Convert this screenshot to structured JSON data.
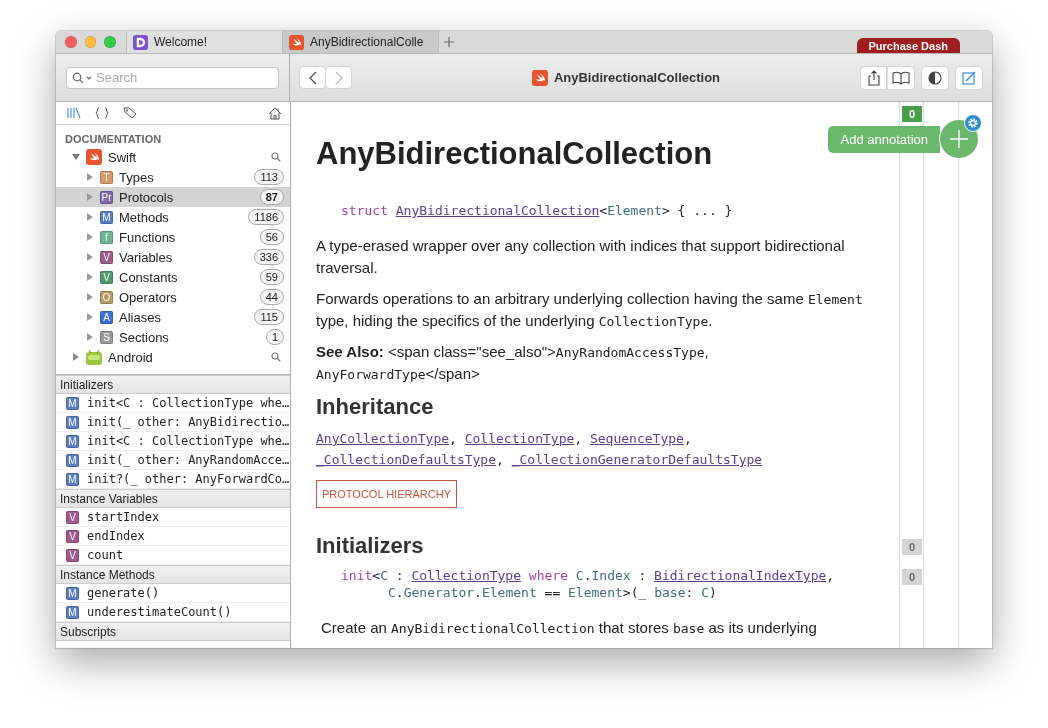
{
  "tabs": [
    {
      "title": "Welcome!",
      "selected": false
    },
    {
      "title": "AnyBidirectionalColle",
      "selected": true
    }
  ],
  "purchase_badge": "Purchase Dash",
  "search": {
    "placeholder": "Search"
  },
  "toolbar": {
    "title": "AnyBidirectionalCollection"
  },
  "tree": {
    "heading": "DOCUMENTATION",
    "items": [
      {
        "label": "Swift",
        "expanded": true,
        "selected": false,
        "children": [
          {
            "badge": "T",
            "color": "#d99a6c",
            "label": "Types",
            "count": "113",
            "selected": false
          },
          {
            "badge": "Pr",
            "color": "#8069a8",
            "label": "Protocols",
            "count": "87",
            "selected": true
          },
          {
            "badge": "M",
            "color": "#5a7fc4",
            "label": "Methods",
            "count": "1186",
            "selected": false
          },
          {
            "badge": "f",
            "color": "#6db592",
            "label": "Functions",
            "count": "56",
            "selected": false
          },
          {
            "badge": "V",
            "color": "#a05a8c",
            "label": "Variables",
            "count": "336",
            "selected": false
          },
          {
            "badge": "V",
            "color": "#4f9a6e",
            "label": "Constants",
            "count": "59",
            "selected": false
          },
          {
            "badge": "O",
            "color": "#b89a64",
            "label": "Operators",
            "count": "44",
            "selected": false
          },
          {
            "badge": "A",
            "color": "#3f6fd1",
            "label": "Aliases",
            "count": "115",
            "selected": false
          },
          {
            "badge": "S",
            "color": "#9a9a9a",
            "label": "Sections",
            "count": "1",
            "selected": false
          }
        ]
      },
      {
        "label": "Android",
        "expanded": false,
        "selected": false
      }
    ]
  },
  "index": [
    {
      "title": "Initializers",
      "items": [
        {
          "badge": "M",
          "color": "#5a7fc4",
          "text": "init<C : CollectionType whe…"
        },
        {
          "badge": "M",
          "color": "#5a7fc4",
          "text": "init(_ other: AnyBidirectio…"
        },
        {
          "badge": "M",
          "color": "#5a7fc4",
          "text": "init<C : CollectionType whe…"
        },
        {
          "badge": "M",
          "color": "#5a7fc4",
          "text": "init(_ other: AnyRandomAcce…"
        },
        {
          "badge": "M",
          "color": "#5a7fc4",
          "text": "init?(_ other: AnyForwardCo…"
        }
      ]
    },
    {
      "title": "Instance Variables",
      "items": [
        {
          "badge": "V",
          "color": "#a05a8c",
          "text": "startIndex"
        },
        {
          "badge": "V",
          "color": "#a05a8c",
          "text": "endIndex"
        },
        {
          "badge": "V",
          "color": "#a05a8c",
          "text": "count"
        }
      ]
    },
    {
      "title": "Instance Methods",
      "items": [
        {
          "badge": "M",
          "color": "#5a7fc4",
          "text": "generate()"
        },
        {
          "badge": "M",
          "color": "#5a7fc4",
          "text": "underestimateCount()"
        }
      ]
    },
    {
      "title": "Subscripts"
    }
  ],
  "annotation": {
    "counter": "0",
    "button": "Add annotation"
  },
  "content": [
    {
      "kind": "title",
      "text": "AnyBidirectionalCollection"
    },
    {
      "kind": "declaration",
      "tokens": [
        {
          "kind": "keyword",
          "text": "struct "
        },
        {
          "kind": "link",
          "text": "AnyBidirectionalCollection"
        },
        {
          "kind": "plain",
          "text": "<"
        },
        {
          "kind": "type",
          "text": "Element"
        },
        {
          "kind": "plain",
          "text": "> { ... }"
        }
      ]
    },
    {
      "kind": "paragraph",
      "tokens": [
        {
          "kind": "text",
          "text": "A type-erased wrapper over any collection with indices that support bidirectional traversal."
        }
      ]
    },
    {
      "kind": "paragraph",
      "tokens": [
        {
          "kind": "text",
          "text": "Forwards operations to an arbitrary underlying collection having the same "
        },
        {
          "kind": "code",
          "text": "Element"
        },
        {
          "kind": "text",
          "text": " type, hiding the specifics of the underlying "
        },
        {
          "kind": "code",
          "text": "CollectionType"
        },
        {
          "kind": "text",
          "text": "."
        }
      ]
    },
    {
      "kind": "paragraph",
      "tokens": [
        {
          "kind": "bold",
          "text": "See Also:"
        },
        {
          "kind": "text",
          "text": " <span class=\"see_also\">"
        },
        {
          "kind": "code",
          "text": "AnyRandomAccessType"
        },
        {
          "kind": "text",
          "text": ","
        },
        {
          "kind": "break"
        },
        {
          "kind": "code",
          "text": "AnyForwardType"
        },
        {
          "kind": "text",
          "text": "</span>"
        }
      ]
    },
    {
      "kind": "heading",
      "text": "Inheritance"
    },
    {
      "kind": "links",
      "tokens": [
        {
          "kind": "link",
          "text": "AnyCollectionType"
        },
        {
          "kind": "plain",
          "text": ", "
        },
        {
          "kind": "link",
          "text": "CollectionType"
        },
        {
          "kind": "plain",
          "text": ", "
        },
        {
          "kind": "link",
          "text": "SequenceType"
        },
        {
          "kind": "plain",
          "text": ","
        },
        {
          "kind": "break"
        },
        {
          "kind": "link",
          "text": "_CollectionDefaultsType"
        },
        {
          "kind": "plain",
          "text": ", "
        },
        {
          "kind": "link",
          "text": "_CollectionGeneratorDefaultsType"
        }
      ]
    },
    {
      "kind": "button",
      "text": "PROTOCOL HIERARCHY"
    },
    {
      "kind": "heading",
      "text": "Initializers",
      "counter": "0"
    },
    {
      "kind": "declaration",
      "counter": "0",
      "tokens": [
        {
          "kind": "keyword",
          "text": "init"
        },
        {
          "kind": "plain",
          "text": "<"
        },
        {
          "kind": "type",
          "text": "C"
        },
        {
          "kind": "plain",
          "text": " : "
        },
        {
          "kind": "link",
          "text": "CollectionType"
        },
        {
          "kind": "keyword",
          "text": " where "
        },
        {
          "kind": "type",
          "text": "C"
        },
        {
          "kind": "plain",
          "text": "."
        },
        {
          "kind": "type",
          "text": "Index"
        },
        {
          "kind": "plain",
          "text": " : "
        },
        {
          "kind": "link",
          "text": "BidirectionalIndexType"
        },
        {
          "kind": "plain",
          "text": ","
        },
        {
          "kind": "break"
        },
        {
          "kind": "indent"
        },
        {
          "kind": "type",
          "text": "C"
        },
        {
          "kind": "plain",
          "text": "."
        },
        {
          "kind": "type",
          "text": "Generator"
        },
        {
          "kind": "plain",
          "text": "."
        },
        {
          "kind": "type",
          "text": "Element"
        },
        {
          "kind": "plain",
          "text": " == "
        },
        {
          "kind": "type",
          "text": "Element"
        },
        {
          "kind": "plain",
          "text": ">(_ "
        },
        {
          "kind": "type",
          "text": "base"
        },
        {
          "kind": "plain",
          "text": ": "
        },
        {
          "kind": "type",
          "text": "C"
        },
        {
          "kind": "plain",
          "text": ")"
        }
      ]
    },
    {
      "kind": "description",
      "tokens": [
        {
          "kind": "text",
          "text": "Create an "
        },
        {
          "kind": "code",
          "text": "AnyBidirectionalCollection"
        },
        {
          "kind": "text",
          "text": " that stores "
        },
        {
          "kind": "code",
          "text": "base"
        },
        {
          "kind": "text",
          "text": " as its underlying"
        }
      ]
    }
  ]
}
